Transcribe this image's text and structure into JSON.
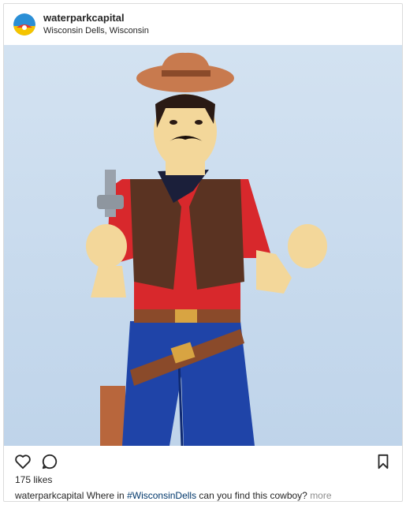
{
  "post": {
    "username": "waterparkcapital",
    "location": "Wisconsin Dells, Wisconsin",
    "likes": "175 likes",
    "caption": {
      "username": "waterparkcapital",
      "text_before": " Where in ",
      "hashtag": "#WisconsinDells",
      "text_after": " can you find this cowboy? ",
      "more": "more"
    }
  },
  "icons": {
    "like": "heart-outline-icon",
    "comment": "comment-bubble-icon",
    "save": "bookmark-icon"
  },
  "colors": {
    "sky": "#c9dcee",
    "hashtag": "#00376b",
    "muted": "#8e8e8e",
    "border": "#dbdbdb"
  }
}
